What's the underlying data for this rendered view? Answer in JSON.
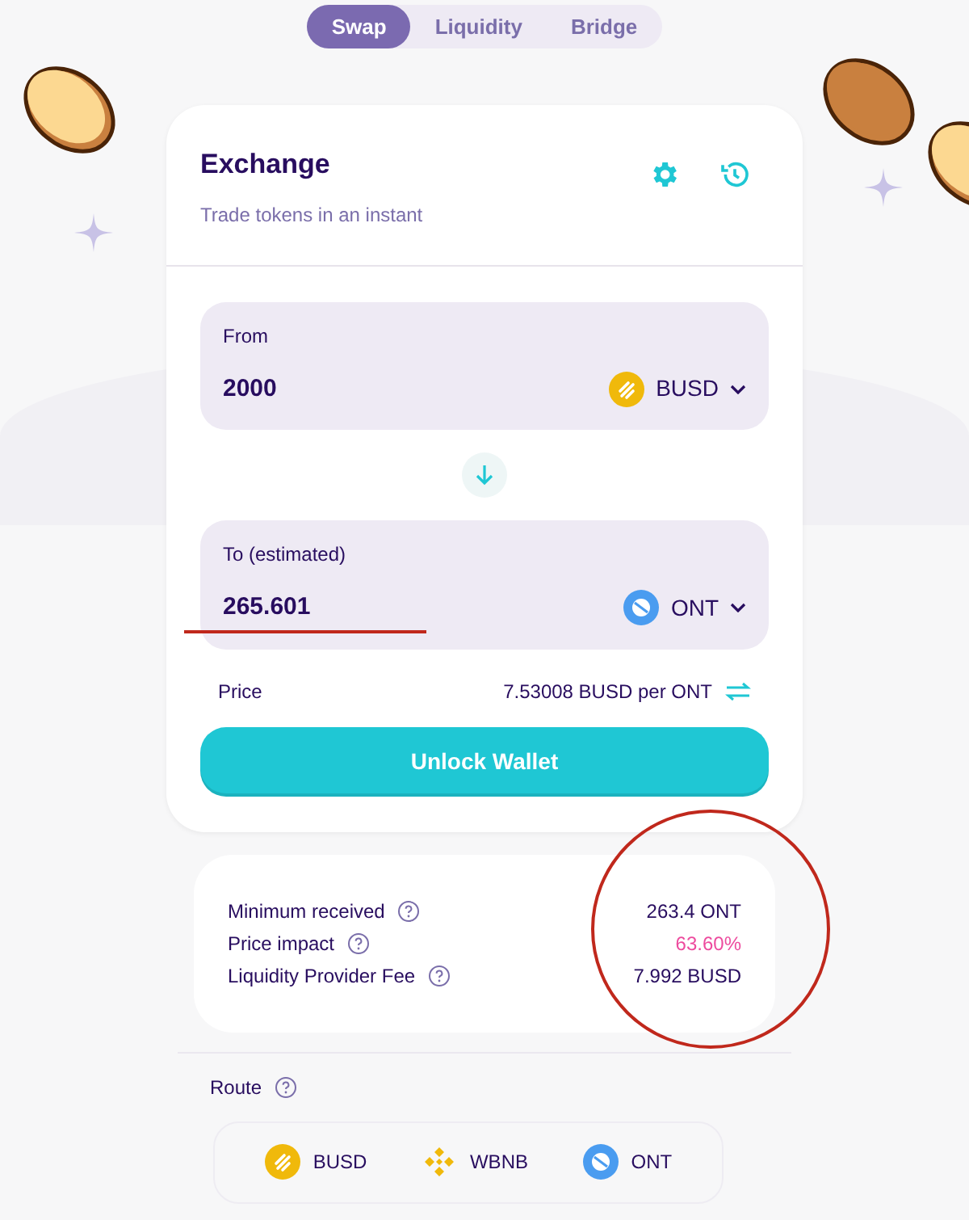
{
  "tabs": [
    {
      "label": "Swap",
      "selected": true
    },
    {
      "label": "Liquidity",
      "selected": false
    },
    {
      "label": "Bridge",
      "selected": false
    }
  ],
  "exchange": {
    "title": "Exchange",
    "subtitle": "Trade tokens in an instant"
  },
  "from": {
    "label": "From",
    "value": "2000",
    "token": {
      "name": "BUSD",
      "kind": "busd"
    }
  },
  "to": {
    "label": "To (estimated)",
    "value": "265.601",
    "token": {
      "name": "ONT",
      "kind": "ont"
    }
  },
  "price": {
    "label": "Price",
    "value": "7.53008 BUSD per ONT"
  },
  "unlock_button": "Unlock Wallet",
  "details": [
    {
      "label": "Minimum received",
      "value": "263.4 ONT",
      "color": "#280d5f"
    },
    {
      "label": "Price impact",
      "value": "63.60%",
      "color": "#ed4b9e"
    },
    {
      "label": "Liquidity Provider Fee",
      "value": "7.992 BUSD",
      "color": "#280d5f"
    }
  ],
  "route": {
    "label": "Route",
    "tokens": [
      {
        "name": "BUSD",
        "kind": "busd"
      },
      {
        "name": "WBNB",
        "kind": "bnb"
      },
      {
        "name": "ONT",
        "kind": "ont"
      }
    ]
  }
}
